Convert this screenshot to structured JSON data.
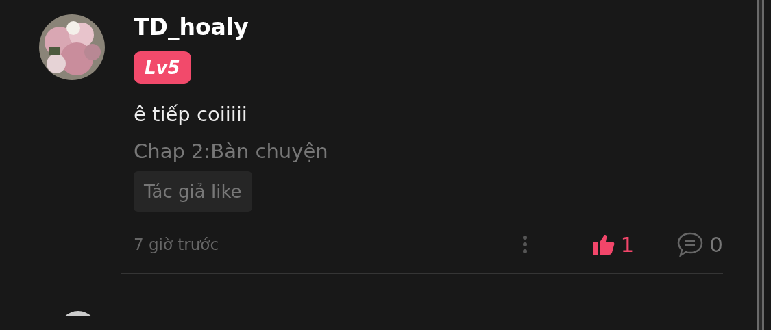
{
  "comment": {
    "username": "TD_hoaly",
    "level_badge": "Lv5",
    "text": "ê tiếp coiiiii",
    "chapter": "Chap 2:Bàn chuyện",
    "tag": "Tác giả like",
    "time": "7 giờ trước",
    "liked": true,
    "like_count": "1",
    "reply_count": "0"
  }
}
